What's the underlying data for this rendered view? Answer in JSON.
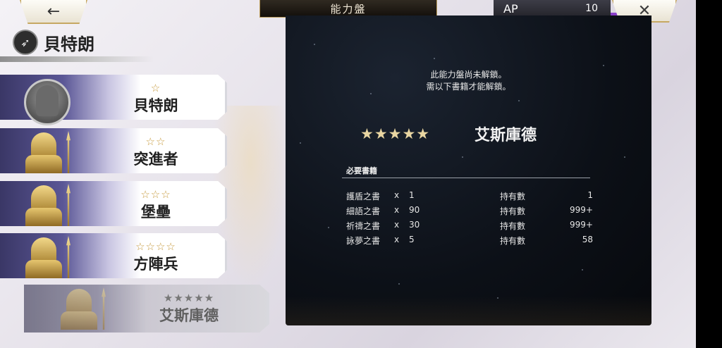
{
  "top_bar": {
    "back_icon": "←",
    "title": "能力盤",
    "ap_label": "AP",
    "ap_value": "10",
    "close_icon": "✕"
  },
  "character": {
    "icon": "➶",
    "name": "貝特朗"
  },
  "jobs": [
    {
      "stars": "☆",
      "name": "貝特朗",
      "locked": false
    },
    {
      "stars": "☆☆",
      "name": "突進者",
      "locked": false
    },
    {
      "stars": "☆☆☆",
      "name": "堡壘",
      "locked": false
    },
    {
      "stars": "☆☆☆☆",
      "name": "方陣兵",
      "locked": false
    },
    {
      "stars": "★★★★★",
      "name": "艾斯庫德",
      "locked": true
    }
  ],
  "panel": {
    "lock_line1": "此能力盤尚未解鎖。",
    "lock_line2": "需以下書籍才能解鎖。",
    "target_stars": "★★★★★",
    "target_name": "艾斯庫德",
    "required_title": "必要書籍",
    "requirements": [
      {
        "book": "護盾之書",
        "x": "x",
        "qty": "1",
        "held_label": "持有數",
        "held": "1"
      },
      {
        "book": "細語之書",
        "x": "x",
        "qty": "90",
        "held_label": "持有數",
        "held": "999+"
      },
      {
        "book": "祈禱之書",
        "x": "x",
        "qty": "30",
        "held_label": "持有數",
        "held": "999+"
      },
      {
        "book": "詠夢之書",
        "x": "x",
        "qty": "5",
        "held_label": "持有數",
        "held": "58"
      }
    ]
  }
}
